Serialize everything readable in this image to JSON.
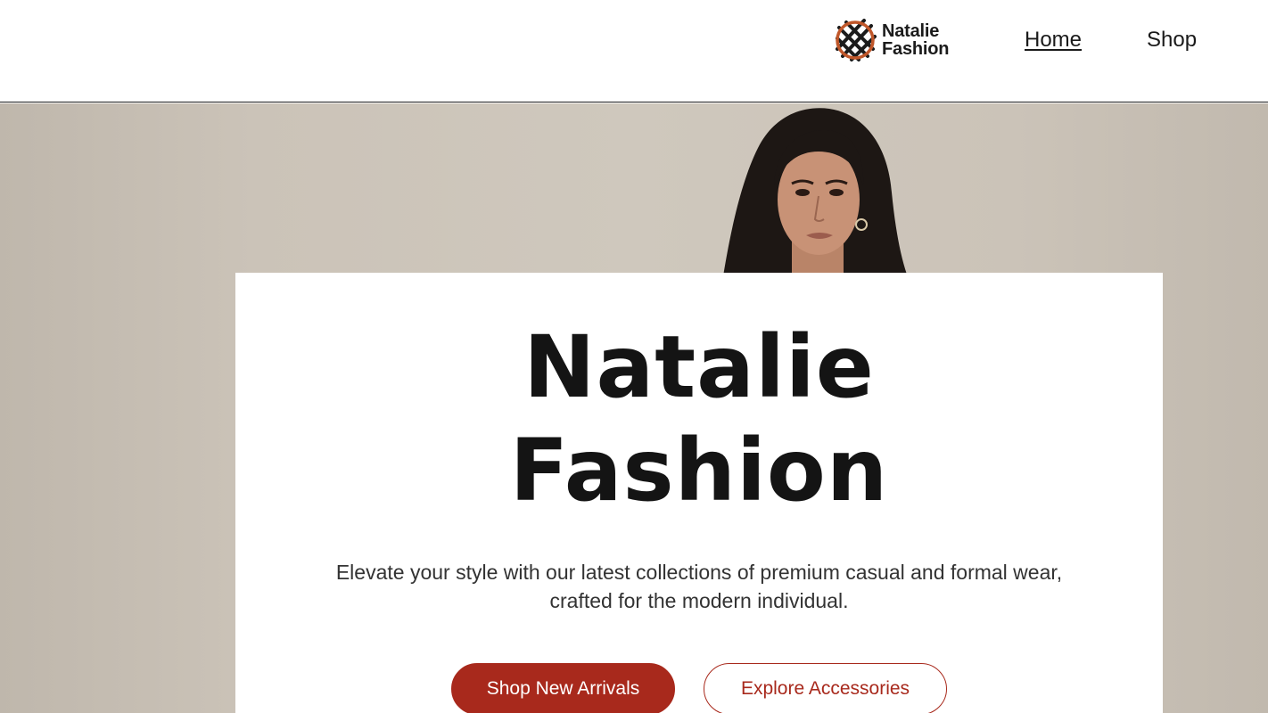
{
  "header": {
    "logo_line1": "Natalie",
    "logo_line2": "Fashion",
    "nav": [
      {
        "label": "Home",
        "active": true
      },
      {
        "label": "Shop",
        "active": false
      }
    ]
  },
  "hero": {
    "title_line1": "Natalie",
    "title_line2": "Fashion",
    "subtitle_line1": "Elevate your style with our latest collections of premium casual and formal wear,",
    "subtitle_line2": "crafted for the modern individual.",
    "primary_button": "Shop New Arrivals",
    "secondary_button": "Explore Accessories"
  },
  "colors": {
    "accent": "#a8291c",
    "logo_orange": "#c0572a",
    "background_beige": "#cbc3b8",
    "text_dark": "#141414"
  },
  "icons": {
    "logo": "woven-knot-logo-icon"
  }
}
